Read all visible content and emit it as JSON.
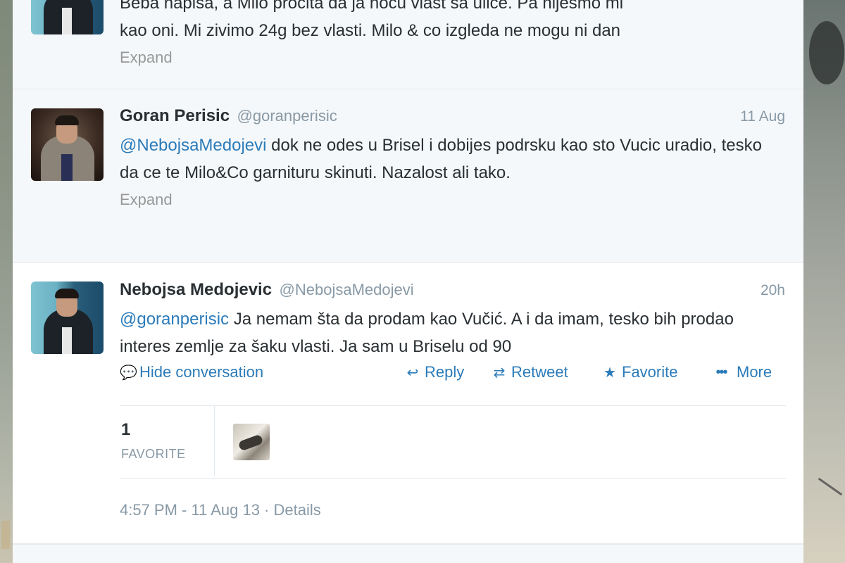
{
  "tweets": [
    {
      "text_line1": "Beba napisa, a Milo procita da ja nocu vlast sa ulice. Pa nijesmo mi",
      "text_line2": "kao oni. Mi zivimo 24g bez vlasti. Milo & co izgleda ne mogu ni dan",
      "expand_label": "Expand"
    },
    {
      "fullname": "Goran Perisic",
      "username": "@goranperisic",
      "time": "11 Aug",
      "mention": "@NebojsaMedojevi",
      "text": " dok ne odes u Brisel i dobijes podrsku kao sto Vucic uradio, tesko da ce te Milo&Co garnituru skinuti. Nazalost ali tako.",
      "expand_label": "Expand"
    },
    {
      "fullname": "Nebojsa Medojevic",
      "username": "@NebojsaMedojevi",
      "time": "20h",
      "mention": "@goranperisic",
      "text": " Ja nemam šta da prodam kao Vučić. A i da imam, tesko bih prodao interes zemlje za šaku vlasti. Ja sam u Briselu od 90",
      "actions": {
        "hide_conversation": "Hide conversation",
        "reply": "Reply",
        "retweet": "Retweet",
        "favorite": "Favorite",
        "more": "More"
      },
      "stats": {
        "favorite_count": "1",
        "favorite_label": "FAVORITE"
      },
      "timestamp": "4:57 PM - 11 Aug 13 · Details"
    }
  ],
  "icons": {
    "hide": "speech-bubble-icon",
    "reply": "reply-arrow-icon",
    "retweet": "retweet-icon",
    "favorite": "star-icon",
    "more": "ellipsis-icon"
  },
  "colors": {
    "link": "#2b7bb9",
    "meta": "#8899a6",
    "text": "#292f33"
  }
}
